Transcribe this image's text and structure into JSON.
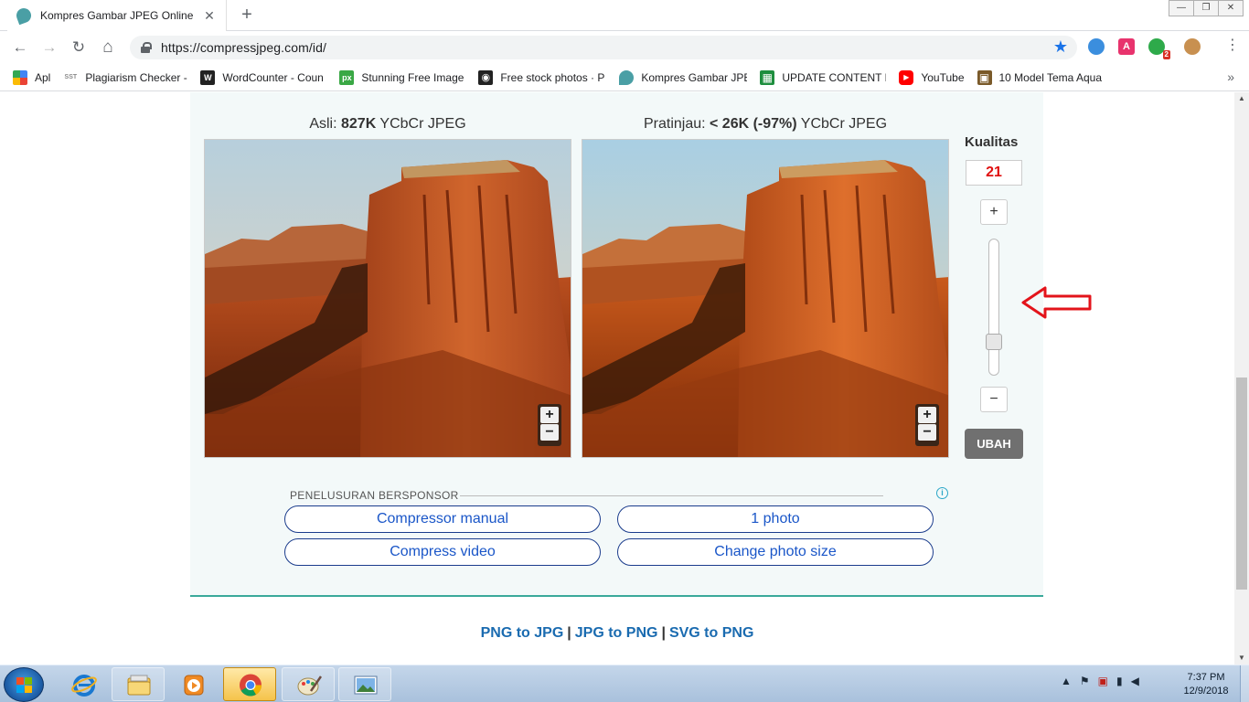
{
  "browser": {
    "tab_title": "Kompres Gambar JPEG Online",
    "tab_close": "✕",
    "new_tab": "+",
    "url": "https://compressjpeg.com/id/",
    "window_controls": [
      "—",
      "❐",
      "✕"
    ],
    "nav": {
      "back": "←",
      "forward": "→",
      "reload": "↻",
      "home": "⌂"
    },
    "star": "★",
    "menu": "⋮",
    "extensions": [
      {
        "icon": "globe-extension-icon",
        "label": "",
        "color": "#3b8ede"
      },
      {
        "icon": "letter-a-extension-icon",
        "label": "A",
        "color": "#e8336d"
      },
      {
        "icon": "green-extension-icon",
        "label": "",
        "color": "#2eaa4a",
        "badge": "2"
      },
      {
        "icon": "profile-avatar-icon",
        "label": "",
        "color": "#c89050"
      }
    ],
    "bookmarks": [
      {
        "label": "Apl",
        "icon": "apps-grid-icon",
        "color": "#4285f4",
        "glyph": ""
      },
      {
        "label": "Plagiarism Checker -",
        "icon": "sst-icon",
        "color": "#8a8a8a",
        "glyph": "SST"
      },
      {
        "label": "WordCounter - Coun",
        "icon": "wordcounter-icon",
        "color": "#222222",
        "glyph": "W"
      },
      {
        "label": "Stunning Free Image",
        "icon": "pixabay-icon",
        "color": "#3aa845",
        "glyph": "px"
      },
      {
        "label": "Free stock photos · P",
        "icon": "camera-icon",
        "color": "#222222",
        "glyph": "◉"
      },
      {
        "label": "Kompres Gambar JPE",
        "icon": "leaf-icon",
        "color": "#4a9fa5",
        "glyph": ""
      },
      {
        "label": "UPDATE CONTENT PI",
        "icon": "sheets-icon",
        "color": "#1e8e3e",
        "glyph": "▦"
      },
      {
        "label": "YouTube",
        "icon": "youtube-icon",
        "color": "#ff0000",
        "glyph": "▶"
      },
      {
        "label": "10 Model Tema Aqua",
        "icon": "aquascape-icon",
        "color": "#7a5a2a",
        "glyph": "▣"
      }
    ],
    "bookmarks_more": "»"
  },
  "compressor": {
    "original_caption": {
      "prefix": "Asli: ",
      "size": "827K",
      "suffix": " YCbCr JPEG"
    },
    "preview_caption": {
      "prefix": "Pratinjau: ",
      "size": "< 26K (-97%)",
      "suffix": " YCbCr JPEG"
    },
    "zoom_in": "+",
    "zoom_out": "−",
    "quality_label": "Kualitas",
    "quality_value": "21",
    "quality_fraction": 0.21,
    "increase": "+",
    "decrease": "−",
    "apply_button": "UBAH"
  },
  "ads": {
    "label": "PENELUSURAN BERSPONSOR",
    "info": "i",
    "buttons": [
      "Compressor manual",
      "1 photo",
      "Compress video",
      "Change photo size"
    ]
  },
  "footer": {
    "links": [
      "PNG to JPG",
      "JPG to PNG",
      "SVG to PNG"
    ],
    "separator": "|"
  },
  "taskbar": {
    "apps": [
      {
        "name": "internet-explorer-icon"
      },
      {
        "name": "file-explorer-icon"
      },
      {
        "name": "media-player-icon"
      },
      {
        "name": "chrome-icon"
      },
      {
        "name": "paint-icon"
      },
      {
        "name": "photo-viewer-icon"
      }
    ],
    "time": "7:37 PM",
    "date": "12/9/2018"
  },
  "colors": {
    "accent_teal": "#3aa99a",
    "quality_red": "#e01010",
    "link_blue": "#1a6bb0",
    "arrow_red": "#e3141b"
  }
}
